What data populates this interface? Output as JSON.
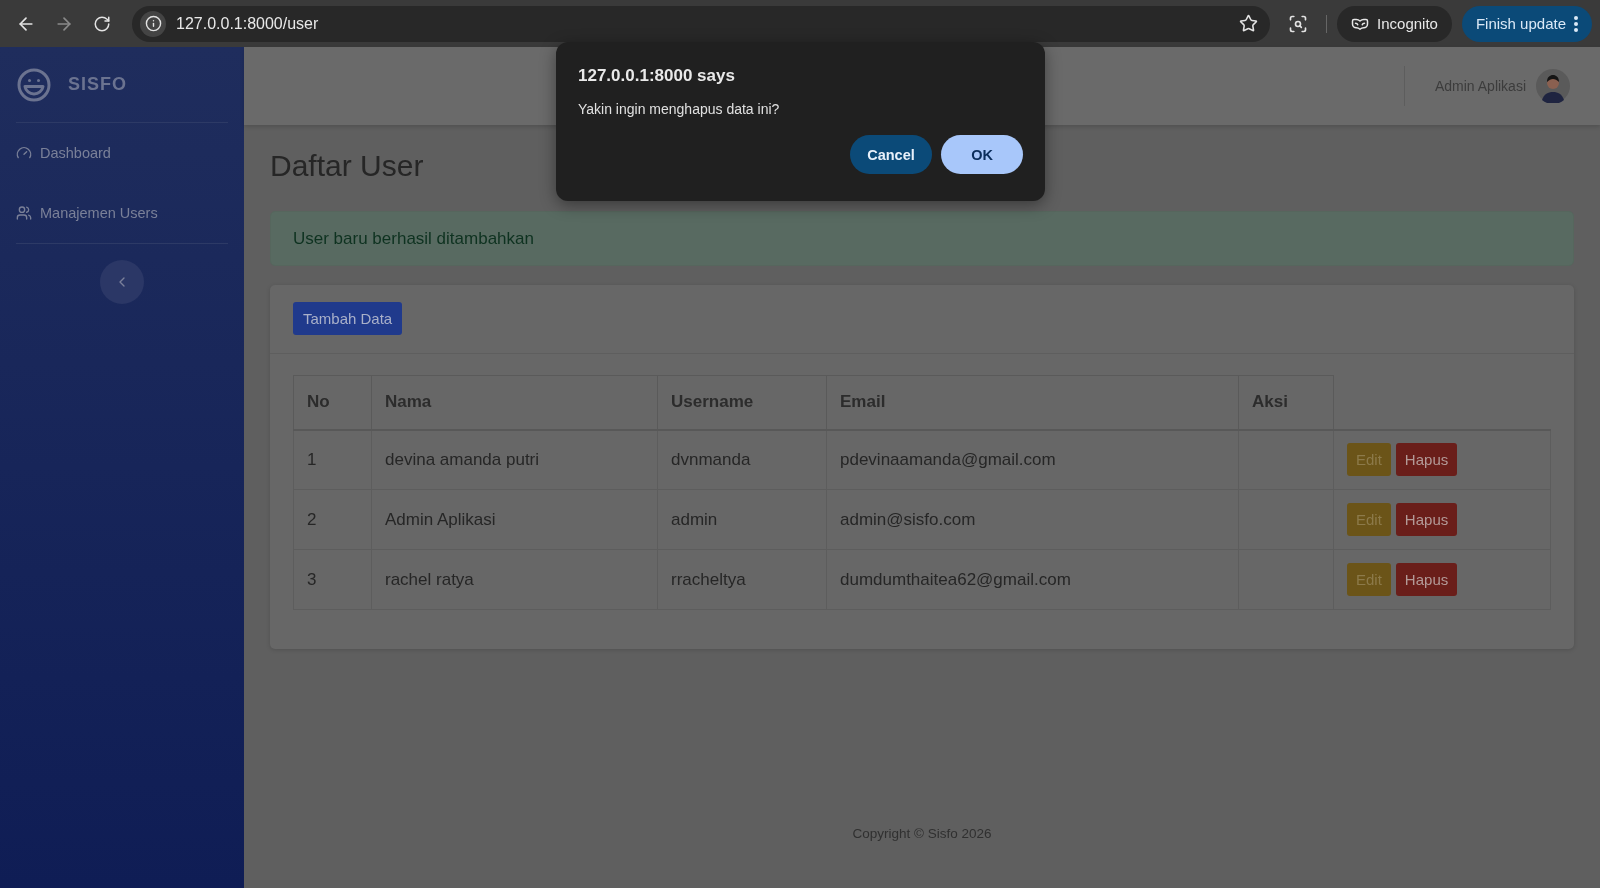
{
  "browser": {
    "url": "127.0.0.1:8000/user",
    "profile": "Incognito",
    "update_button": "Finish update"
  },
  "sidebar": {
    "brand": "SISFO",
    "items": [
      {
        "label": "Dashboard",
        "kind": "dashboard"
      },
      {
        "label": "Manajemen Users",
        "kind": "users"
      }
    ]
  },
  "topbar": {
    "user_name": "Admin Aplikasi"
  },
  "page_title": "Daftar User",
  "alert": "User baru berhasil ditambahkan",
  "add_button": "Tambah Data",
  "table": {
    "columns": [
      "No",
      "Nama",
      "Username",
      "Email",
      "Aksi"
    ],
    "rows": [
      {
        "cells": [
          "1",
          "devina amanda putri",
          "dvnmanda",
          "pdevinaamanda@gmail.com"
        ],
        "actions": [
          "Edit",
          "Hapus"
        ]
      },
      {
        "cells": [
          "2",
          "Admin Aplikasi",
          "admin",
          "admin@sisfo.com"
        ],
        "actions": [
          "Edit",
          "Hapus"
        ]
      },
      {
        "cells": [
          "3",
          "rachel ratya",
          "rracheltya",
          "dumdumthaitea62@gmail.com"
        ],
        "actions": [
          "Edit",
          "Hapus"
        ]
      }
    ]
  },
  "footer": "Copyright © Sisfo 2026",
  "dialog": {
    "title": "127.0.0.1:8000 says",
    "message": "Yakin ingin menghapus data ini?",
    "buttons": [
      {
        "label": "Cancel",
        "kind": "secondary"
      },
      {
        "label": "OK",
        "kind": "primary"
      }
    ]
  }
}
